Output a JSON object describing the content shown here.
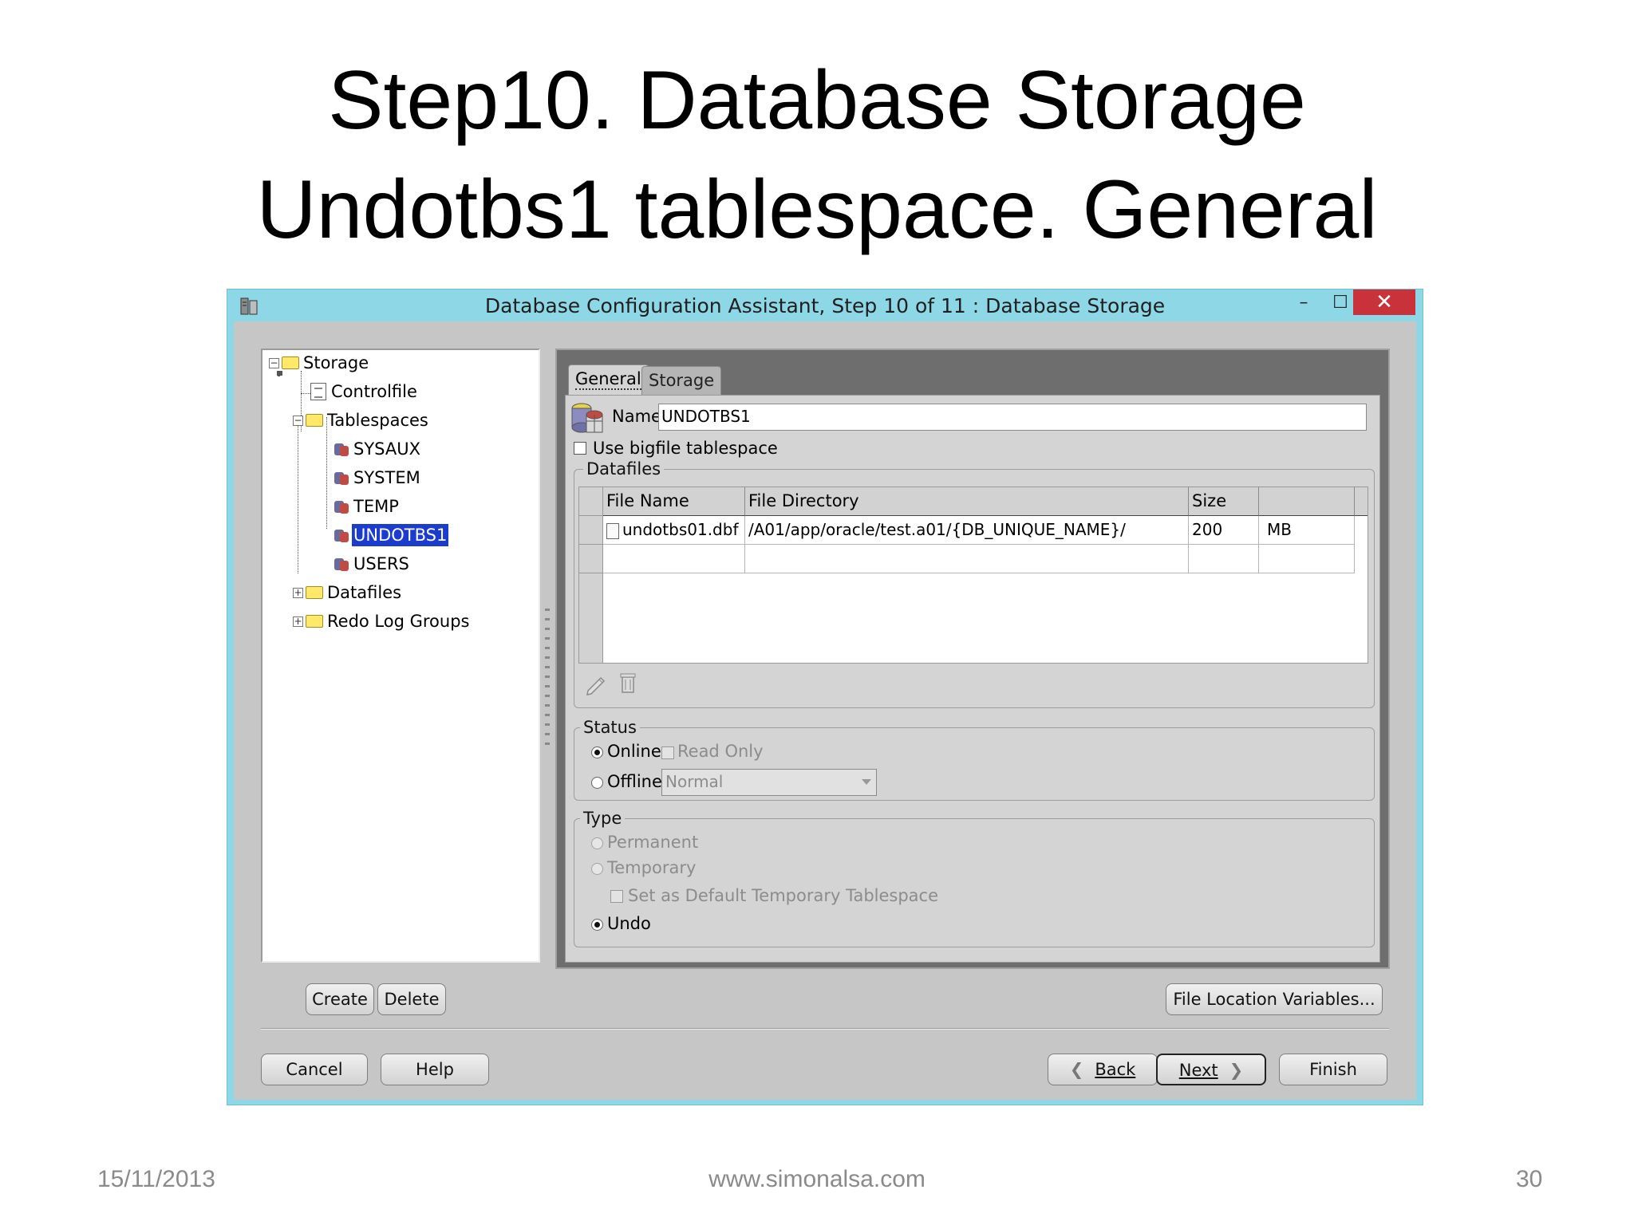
{
  "slide": {
    "title_line1": "Step10. Database Storage",
    "title_line2": "Undotbs1 tablespace. General",
    "footer_date": "15/11/2013",
    "footer_site": "www.simonalsa.com",
    "footer_page": "30"
  },
  "window": {
    "title": "Database Configuration Assistant, Step 10 of 11 : Database Storage",
    "app_icon": "database-icon",
    "minimize": "–",
    "maximize": "☐",
    "close": "✕"
  },
  "tree": {
    "root": "Storage",
    "controlfile": "Controlfile",
    "tablespaces": "Tablespaces",
    "items": [
      "SYSAUX",
      "SYSTEM",
      "TEMP",
      "UNDOTBS1",
      "USERS"
    ],
    "selected": "UNDOTBS1",
    "datafiles": "Datafiles",
    "redo": "Redo Log Groups"
  },
  "tabs": {
    "general": "General",
    "storage": "Storage",
    "active": "General"
  },
  "general": {
    "name_label": "Name:",
    "name_value": "UNDOTBS1",
    "bigfile_label": "Use bigfile tablespace",
    "bigfile_checked": false,
    "datafiles_group": "Datafiles",
    "columns": [
      "File Name",
      "File Directory",
      "Size",
      ""
    ],
    "rows": [
      {
        "file_name": "undotbs01.dbf",
        "directory": "/A01/app/oracle/test.a01/{DB_UNIQUE_NAME}/",
        "size": "200",
        "unit": "MB"
      }
    ],
    "status_group": "Status",
    "online_label": "Online",
    "read_only_label": "Read Only",
    "offline_label": "Offline",
    "offline_mode": "Normal",
    "status_selected": "Online",
    "type_group": "Type",
    "permanent_label": "Permanent",
    "temporary_label": "Temporary",
    "default_temp_label": "Set as Default Temporary Tablespace",
    "undo_label": "Undo",
    "type_selected": "Undo"
  },
  "buttons": {
    "create": "Create",
    "delete": "Delete",
    "file_location": "File Location Variables...",
    "cancel": "Cancel",
    "help": "Help",
    "back": "Back",
    "next": "Next",
    "finish": "Finish"
  },
  "colors": {
    "window_frame": "#8dd7e6",
    "selection": "#1c3ccf",
    "close_button": "#c9323a"
  }
}
